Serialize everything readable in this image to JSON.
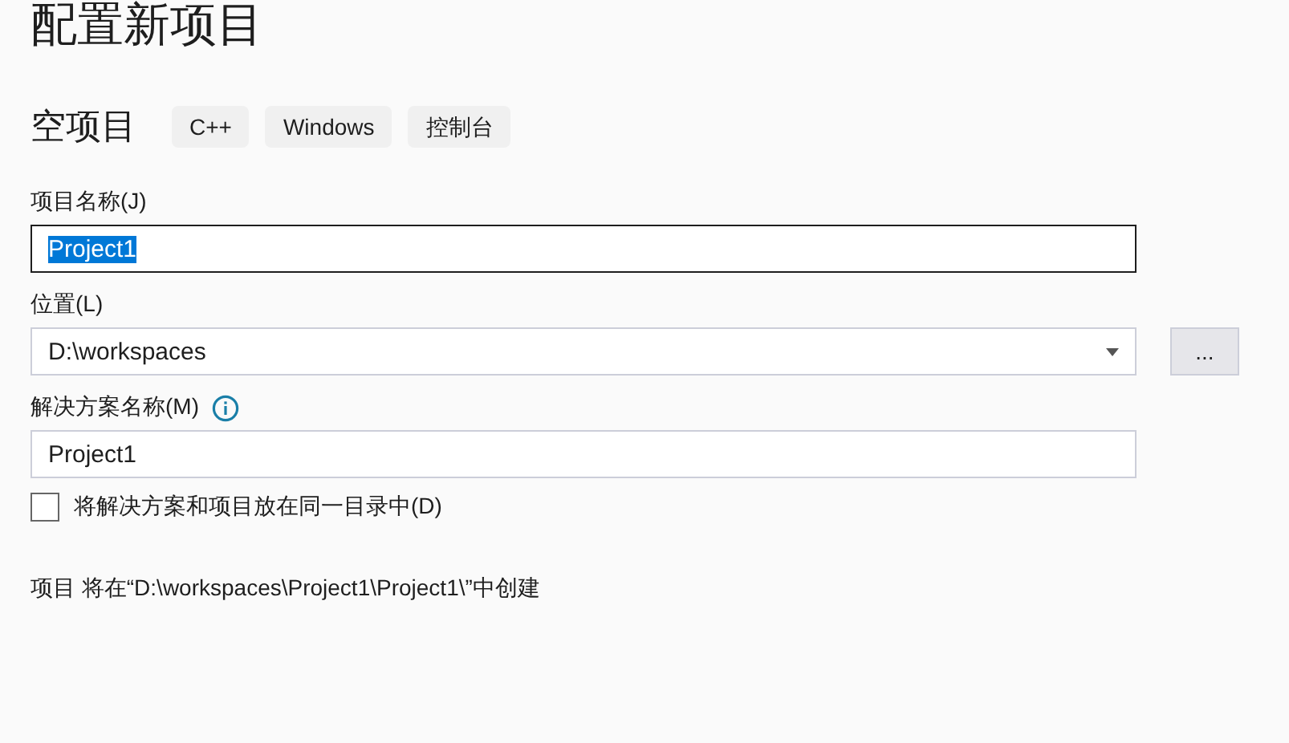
{
  "title": "配置新项目",
  "template": {
    "name": "空项目",
    "tags": [
      "C++",
      "Windows",
      "控制台"
    ]
  },
  "fields": [
    {
      "kind": "text",
      "label": "项目名称(J)",
      "value": "Project1",
      "text_selected": true,
      "focused": true
    },
    {
      "kind": "combo",
      "label": "位置(L)",
      "value": "D:\\workspaces",
      "button": "..."
    },
    {
      "kind": "text",
      "label": "解决方案名称(M)",
      "info": true,
      "value": "Project1",
      "text_selected": false,
      "focused": false
    }
  ],
  "same_directory": {
    "label": "将解决方案和项目放在同一目录中(D)",
    "checked": false
  },
  "summary": "项目 将在“D:\\workspaces\\Project1\\Project1\\”中创建"
}
